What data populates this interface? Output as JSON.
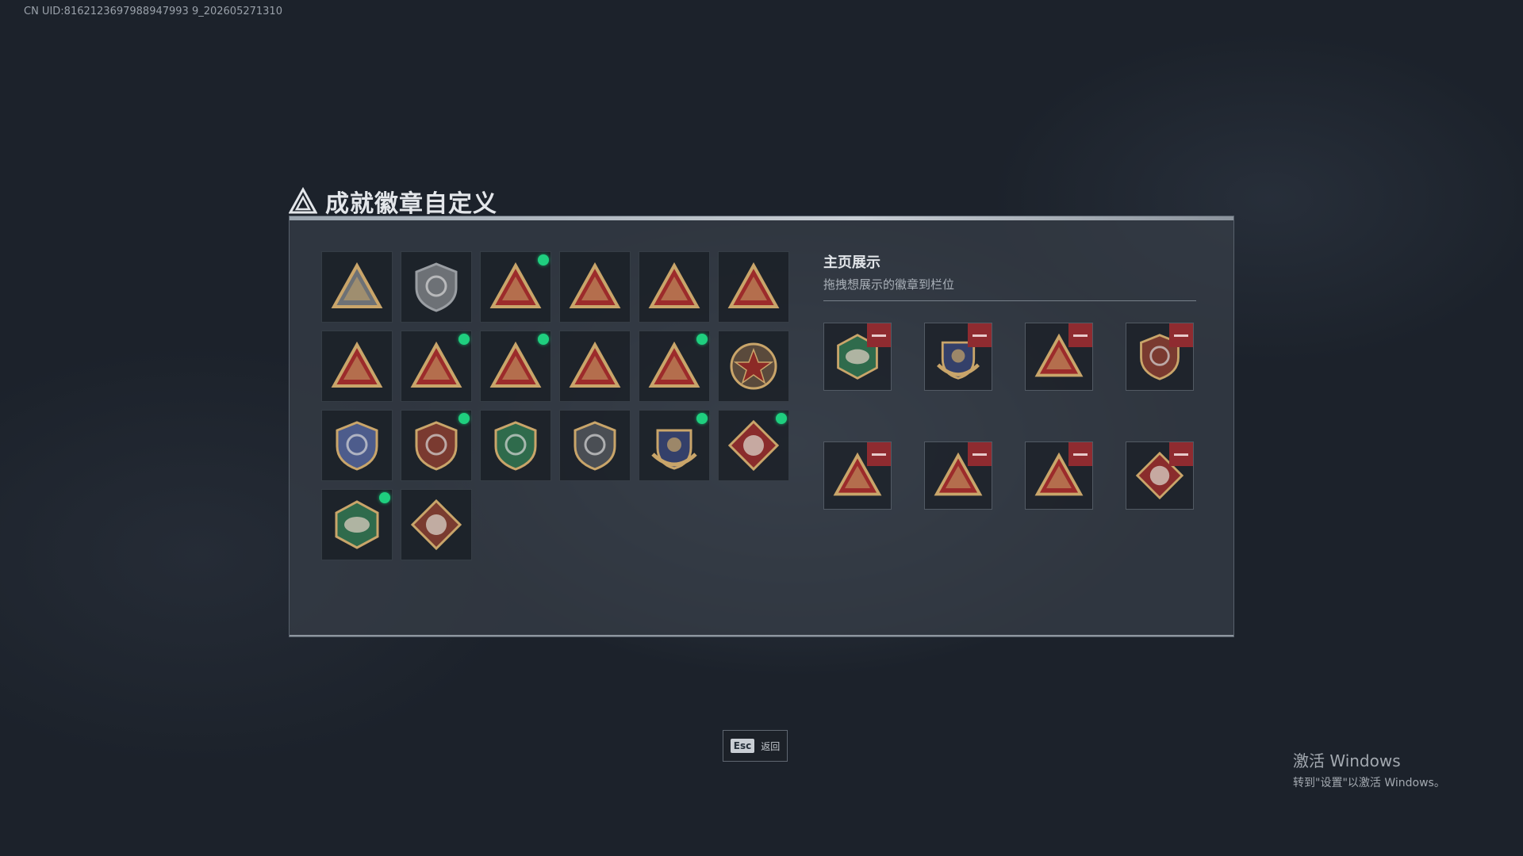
{
  "uid_text": "CN UID:8162123697988947993 9_202605271310",
  "page": {
    "title": "成就徽章自定义",
    "title_icon": "triangle-logo-icon"
  },
  "badges": [
    {
      "icon": "shield-triangle-badge",
      "new": false,
      "color": "#6d7176"
    },
    {
      "icon": "helicopter-badge",
      "new": false,
      "color": "#6d7176"
    },
    {
      "icon": "sb-triangle-badge",
      "new": true,
      "color": "#9c2b2b"
    },
    {
      "icon": "tank-triangle-badge",
      "new": false,
      "color": "#9c2b2b"
    },
    {
      "icon": "hand-triangle-badge",
      "new": false,
      "color": "#9c2b2b"
    },
    {
      "icon": "boat-triangle-badge",
      "new": false,
      "color": "#9c2b2b"
    },
    {
      "icon": "number-one-triangle-badge",
      "new": false,
      "color": "#9c2b2b"
    },
    {
      "icon": "soldier-triangle-badge",
      "new": true,
      "color": "#9c2b2b"
    },
    {
      "icon": "helmet-triangle-badge",
      "new": true,
      "color": "#9c2b2b"
    },
    {
      "icon": "trooper-triangle-badge",
      "new": false,
      "color": "#9c2b2b"
    },
    {
      "icon": "rocket-triangle-badge",
      "new": true,
      "color": "#9c2b2b"
    },
    {
      "icon": "star-round-badge",
      "new": false,
      "color": "#8c2a26"
    },
    {
      "icon": "blue-shield-badge",
      "new": false,
      "color": "#4d5c8c"
    },
    {
      "icon": "helmet-shield-badge",
      "new": true,
      "color": "#7a3a30"
    },
    {
      "icon": "crosshair-green-shield-badge",
      "new": false,
      "color": "#2f6b4c"
    },
    {
      "icon": "rifle-shield-badge",
      "new": false,
      "color": "#4a4e54"
    },
    {
      "icon": "winged-crest-badge",
      "new": true,
      "color": "#34406a"
    },
    {
      "icon": "wolf-diamond-badge",
      "new": true,
      "color": "#8a2c2c"
    },
    {
      "icon": "eagle-hexagon-badge",
      "new": true,
      "color": "#2f6b4c"
    },
    {
      "icon": "dragon-diamond-badge",
      "new": false,
      "color": "#7a3b30"
    }
  ],
  "showcase": {
    "title": "主页展示",
    "subtitle": "拖拽想展示的徽章到栏位",
    "slots": [
      {
        "icon": "eagle-hexagon-badge",
        "color": "#2f6b4c"
      },
      {
        "icon": "winged-crest-badge",
        "color": "#34406a"
      },
      {
        "icon": "sb-triangle-badge",
        "color": "#9c2b2b"
      },
      {
        "icon": "helmet-shield-badge",
        "color": "#7a3a30"
      },
      {
        "icon": "helmet-triangle-badge",
        "color": "#9c2b2b"
      },
      {
        "icon": "rocket-triangle-badge",
        "color": "#9c2b2b"
      },
      {
        "icon": "soldier-triangle-badge",
        "color": "#9c2b2b"
      },
      {
        "icon": "wolf-diamond-badge",
        "color": "#8a2c2c"
      }
    ]
  },
  "footer": {
    "esc_key": "Esc",
    "esc_label": "返回"
  },
  "windows_watermark": {
    "title": "激活 Windows",
    "subtitle": "转到\"设置\"以激活 Windows。"
  }
}
